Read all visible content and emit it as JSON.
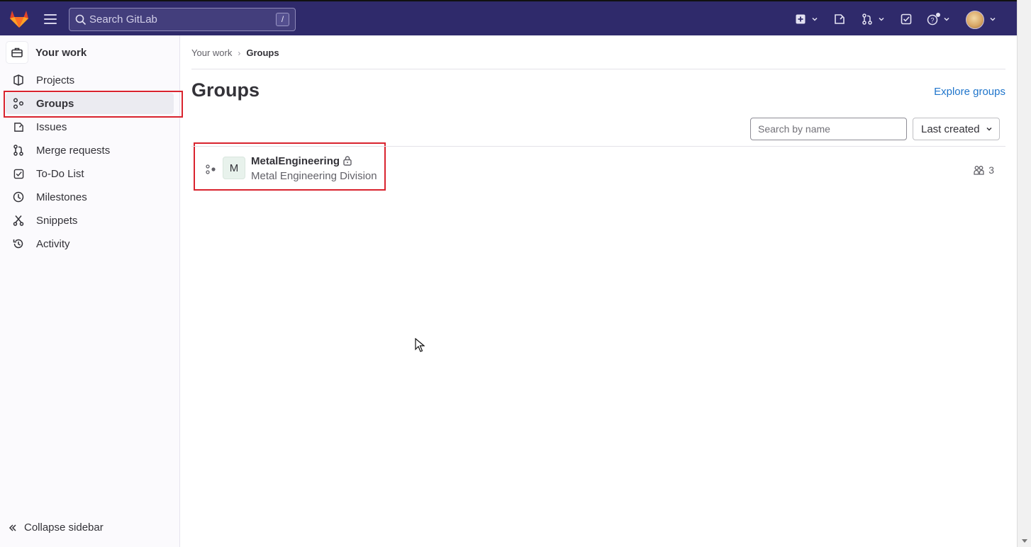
{
  "topbar": {
    "search_placeholder": "Search GitLab",
    "search_shortcut": "/"
  },
  "sidebar": {
    "title": "Your work",
    "items": [
      {
        "label": "Projects",
        "icon": "project-icon"
      },
      {
        "label": "Groups",
        "icon": "group-icon",
        "active": true
      },
      {
        "label": "Issues",
        "icon": "issues-icon"
      },
      {
        "label": "Merge requests",
        "icon": "merge-request-icon"
      },
      {
        "label": "To-Do List",
        "icon": "todo-icon"
      },
      {
        "label": "Milestones",
        "icon": "milestone-icon"
      },
      {
        "label": "Snippets",
        "icon": "snippet-icon"
      },
      {
        "label": "Activity",
        "icon": "activity-icon"
      }
    ],
    "collapse_label": "Collapse sidebar"
  },
  "breadcrumb": {
    "parent": "Your work",
    "current": "Groups"
  },
  "main": {
    "title": "Groups",
    "explore_link": "Explore groups",
    "filter_placeholder": "Search by name",
    "sort_label": "Last created"
  },
  "groups": [
    {
      "avatar_letter": "M",
      "name": "MetalEngineering",
      "description": "Metal Engineering Division",
      "visibility": "private",
      "members": "3"
    }
  ],
  "colors": {
    "topbar": "#2f2a6b",
    "accent_link": "#1f75cb",
    "highlight": "#d9232e"
  }
}
